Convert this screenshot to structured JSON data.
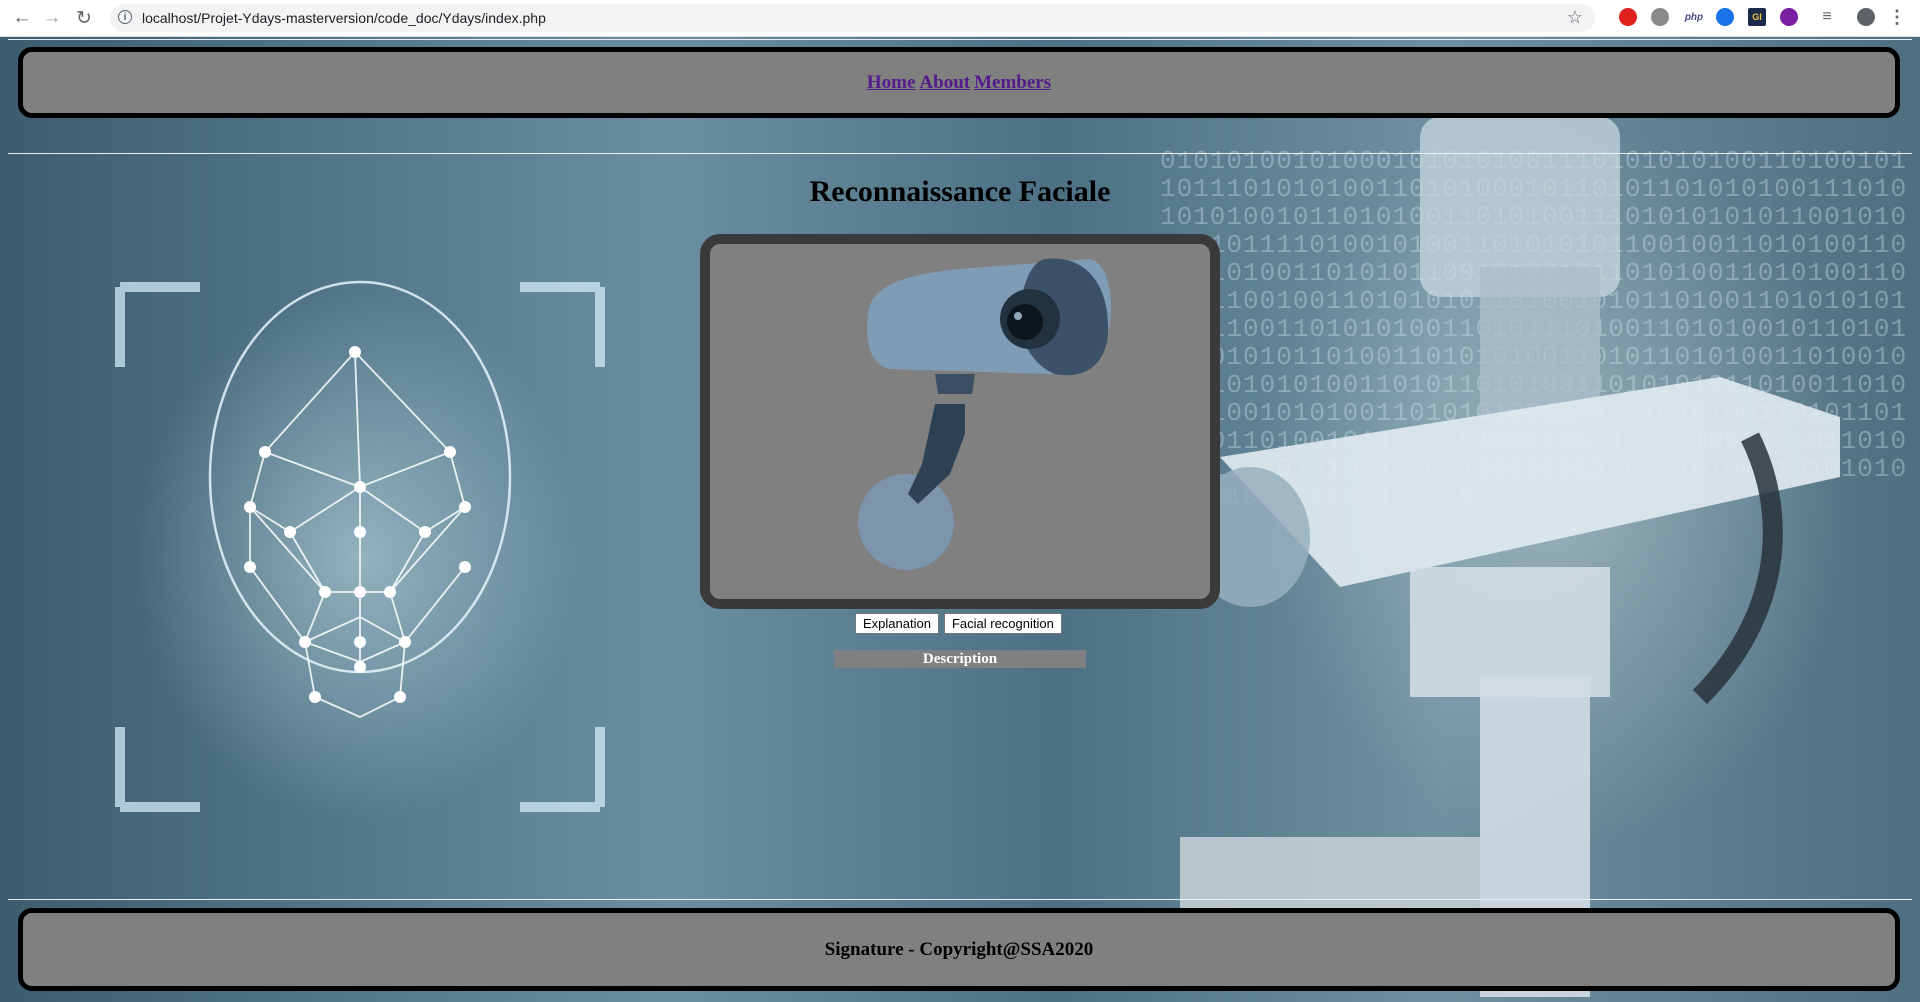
{
  "browser": {
    "url": "localhost/Projet-Ydays-masterversion/code_doc/Ydays/index.php",
    "back_icon": "←",
    "forward_icon": "→",
    "reload_icon": "↻",
    "info_icon": "i",
    "star_icon": "☆",
    "menu_icon": "⋮",
    "php_ext_label": "php",
    "gi_ext_label": "GI"
  },
  "nav": {
    "links": [
      "Home",
      "About",
      "Members"
    ]
  },
  "main": {
    "title": "Reconnaissance Faciale",
    "buttons": {
      "explanation": "Explanation",
      "facial_recognition": "Facial recognition"
    },
    "description": "Description"
  },
  "footer": {
    "text": "Signature - Copyright@SSA2020"
  },
  "colors": {
    "bar_bg": "#808080",
    "link": "#551a8b",
    "frame_border": "#3a3a3a"
  }
}
